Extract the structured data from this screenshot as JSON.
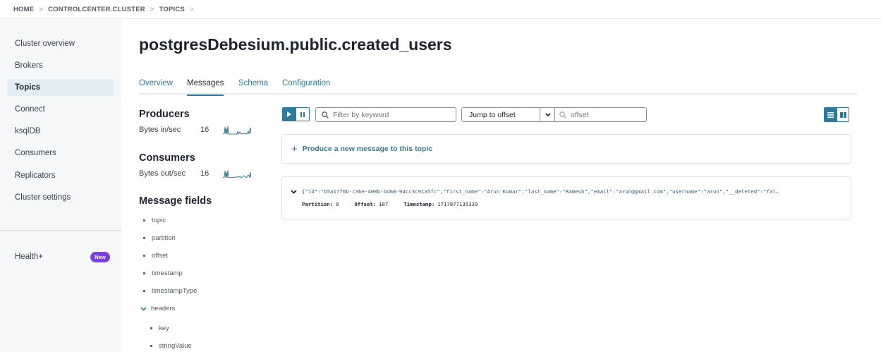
{
  "breadcrumb": {
    "home": "HOME",
    "cluster": "CONTROLCENTER.CLUSTER",
    "topics": "TOPICS",
    "separator": ">"
  },
  "sidebar": {
    "items": [
      {
        "label": "Cluster overview"
      },
      {
        "label": "Brokers"
      },
      {
        "label": "Topics"
      },
      {
        "label": "Connect"
      },
      {
        "label": "ksqlDB"
      },
      {
        "label": "Consumers"
      },
      {
        "label": "Replicators"
      },
      {
        "label": "Cluster settings"
      }
    ],
    "active": "Topics",
    "health": {
      "label": "Health+",
      "badge": "New"
    }
  },
  "page": {
    "title": "postgresDebesium.public.created_users"
  },
  "tabs": [
    {
      "label": "Overview"
    },
    {
      "label": "Messages"
    },
    {
      "label": "Schema"
    },
    {
      "label": "Configuration"
    }
  ],
  "active_tab": "Messages",
  "producers": {
    "title": "Producers",
    "label": "Bytes in/sec",
    "value": "16"
  },
  "consumers": {
    "title": "Consumers",
    "label": "Bytes out/sec",
    "value": "16"
  },
  "message_fields": {
    "title": "Message fields",
    "fields": [
      "topic",
      "partition",
      "offset",
      "timestamp",
      "timestampType"
    ],
    "expandable": {
      "label": "headers",
      "children": [
        "key",
        "stringValue"
      ]
    }
  },
  "toolbar": {
    "filter_placeholder": "Filter by keyword",
    "jump_label": "Jump to offset",
    "offset_placeholder": "offset"
  },
  "produce": {
    "label": "Produce a new message to this topic"
  },
  "messages": [
    {
      "value": "{\"id\":\"b5a17f6b-c3be-400b-bd68-94cc3c91a5fc\",\"first_name\":\"Arun Kumar\",\"last_name\":\"Ramesh\",\"email\":\"arun@gmail.com\",\"username\":\"arun\",\"__deleted\":\"fal…",
      "partition_label": "Partition:",
      "partition": "0",
      "offset_label": "Offset:",
      "offset": "107",
      "timestamp_label": "Timestamp:",
      "timestamp": "1717877135339"
    }
  ],
  "colors": {
    "accent": "#2f7a9a",
    "badge": "#7b3fe4",
    "sidebar_bg": "#f6f7f9",
    "active_item_bg": "#e3eef4"
  }
}
